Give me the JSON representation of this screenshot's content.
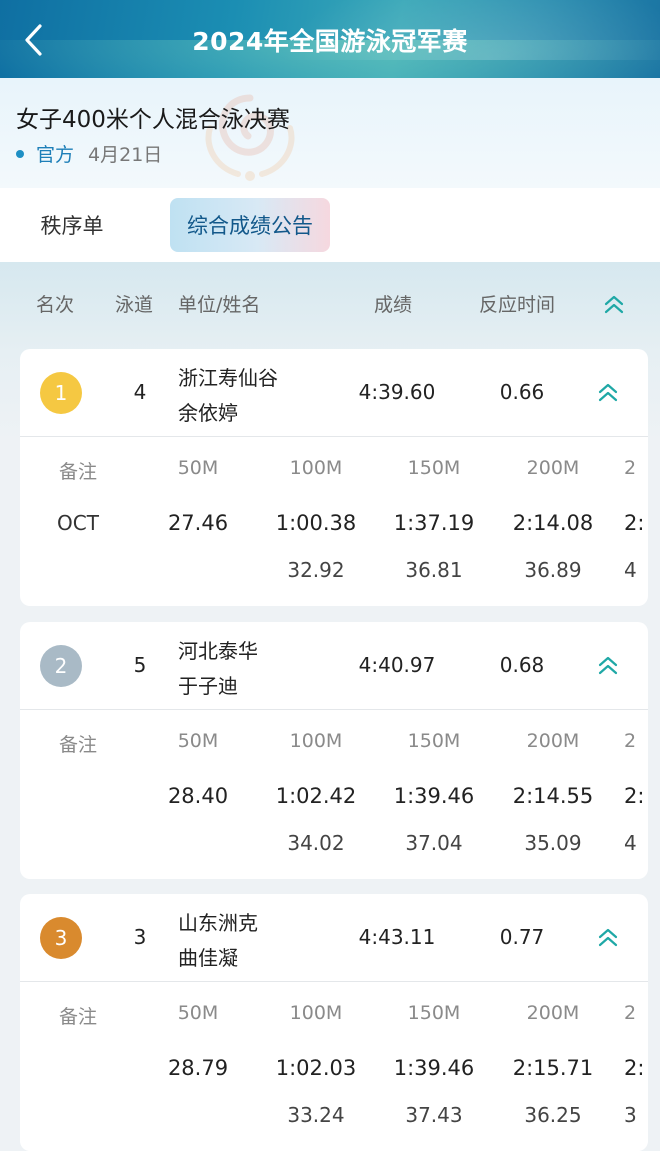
{
  "header": {
    "title": "2024年全国游泳冠军赛"
  },
  "event": {
    "title": "女子400米个人混合泳决赛",
    "source": "官方",
    "date": "4月21日"
  },
  "tabs": [
    {
      "label": "秩序单",
      "active": false
    },
    {
      "label": "综合成绩公告",
      "active": true
    }
  ],
  "columns": {
    "rank": "名次",
    "lane": "泳道",
    "team_name": "单位/姓名",
    "result": "成绩",
    "reaction": "反应时间"
  },
  "split_headers": {
    "remark": "备注",
    "m50": "50M",
    "m100": "100M",
    "m150": "150M",
    "m200": "200M",
    "m250": "2"
  },
  "colors": {
    "gold": "#f5c842",
    "silver": "#a9bac6",
    "bronze": "#d98a2e",
    "accent": "#1fa8a6",
    "brand": "#1a7fb0"
  },
  "icons": {
    "back": "chevron-left-icon",
    "collapse": "double-chevron-up-icon"
  },
  "results": [
    {
      "rank": "1",
      "lane": "4",
      "team": "浙江寿仙谷",
      "athlete": "余依婷",
      "time": "4:39.60",
      "reaction": "0.66",
      "remark": "OCT",
      "cumulative": [
        "27.46",
        "1:00.38",
        "1:37.19",
        "2:14.08",
        "2:"
      ],
      "laps": [
        "32.92",
        "36.81",
        "36.89",
        "4"
      ]
    },
    {
      "rank": "2",
      "lane": "5",
      "team": "河北泰华",
      "athlete": "于子迪",
      "time": "4:40.97",
      "reaction": "0.68",
      "remark": "",
      "cumulative": [
        "28.40",
        "1:02.42",
        "1:39.46",
        "2:14.55",
        "2:"
      ],
      "laps": [
        "34.02",
        "37.04",
        "35.09",
        "4"
      ]
    },
    {
      "rank": "3",
      "lane": "3",
      "team": "山东洲克",
      "athlete": "曲佳凝",
      "time": "4:43.11",
      "reaction": "0.77",
      "remark": "",
      "cumulative": [
        "28.79",
        "1:02.03",
        "1:39.46",
        "2:15.71",
        "2:"
      ],
      "laps": [
        "33.24",
        "37.43",
        "36.25",
        "3"
      ]
    }
  ]
}
